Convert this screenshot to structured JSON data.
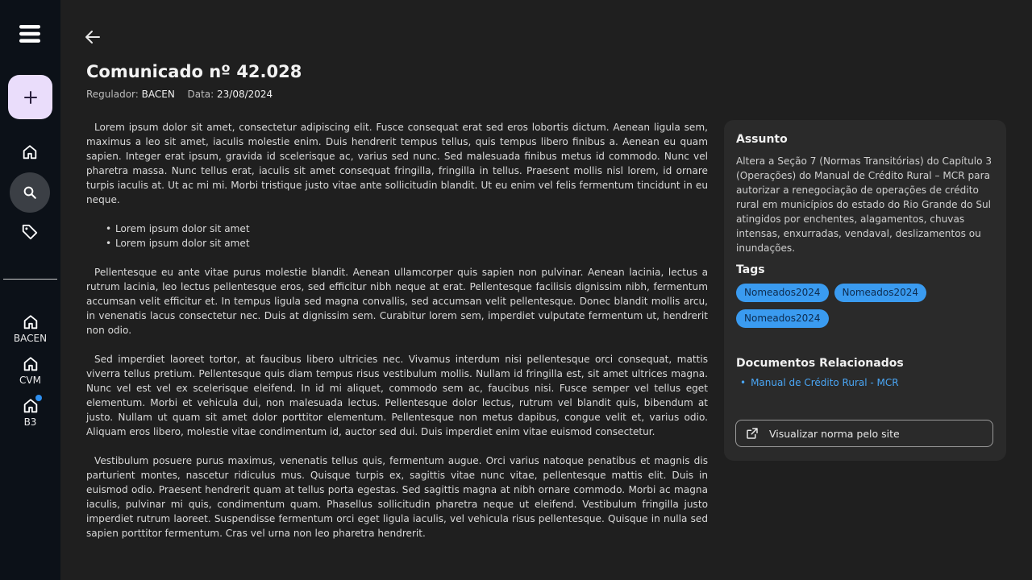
{
  "rail": {
    "regulators": [
      {
        "label": "BACEN"
      },
      {
        "label": "CVM"
      },
      {
        "label": "B3",
        "notification": true
      }
    ]
  },
  "document": {
    "title": "Comunicado nº 42.028",
    "regulator_label": "Regulador:",
    "regulator_value": "BACEN",
    "date_label": "Data:",
    "date_value": "23/08/2024",
    "paragraphs": [
      "Lorem ipsum dolor sit amet, consectetur adipiscing elit. Fusce consequat erat sed eros lobortis dictum. Aenean ligula sem, maximus a leo sit amet, iaculis molestie enim. Duis hendrerit tempus tellus, quis tempus libero finibus a. Aenean eu quam sapien. Integer erat ipsum, gravida id scelerisque ac, varius sed nunc. Sed malesuada finibus metus id commodo. Nunc vel pharetra massa. Nunc tellus erat, iaculis sit amet consequat fringilla, fringilla in tellus. Praesent mollis nisl lorem, id ornare turpis iaculis at. Ut ac mi mi. Morbi tristique justo vitae ante sollicitudin blandit. Ut eu enim vel felis fermentum tincidunt in eu neque.",
      "Pellentesque eu ante vitae purus molestie blandit. Aenean ullamcorper quis sapien non pulvinar. Aenean lacinia, lectus a rutrum lacinia, leo lectus pellentesque eros, sed efficitur nibh neque at erat. Pellentesque facilisis dignissim nibh, fermentum accumsan velit efficitur et. In tempus ligula sed magna convallis, sed accumsan velit pellentesque. Donec blandit mollis arcu, in venenatis lacus consectetur nec. Duis at dignissim sem. Curabitur lorem sem, imperdiet vulputate fermentum ut, hendrerit non odio.",
      "Sed imperdiet laoreet tortor, at faucibus libero ultricies nec. Vivamus interdum nisi pellentesque orci consequat, mattis viverra tellus pretium. Pellentesque quis diam tempus risus vestibulum mollis. Nullam id fringilla est, sit amet ultrices magna. Nunc vel est vel ex scelerisque eleifend. In id mi aliquet, commodo sem ac, faucibus nisi. Fusce semper vel tellus eget elementum. Morbi et vehicula dui, non malesuada lectus. Pellentesque dolor lectus, rutrum vel blandit quis, bibendum at justo. Nullam ut quam sit amet dolor porttitor elementum. Pellentesque non metus dapibus, congue velit et, varius odio. Aliquam eros libero, molestie vitae condimentum id, auctor sed dui. Duis imperdiet enim vitae euismod consectetur.",
      "Vestibulum posuere purus maximus, venenatis tellus quis, fermentum augue. Orci varius natoque penatibus et magnis dis parturient montes, nascetur ridiculus mus. Quisque turpis ex, sagittis vitae nunc vitae, pellentesque mattis elit. Duis in euismod odio. Praesent hendrerit quam at tellus porta egestas. Sed sagittis magna at nibh ornare commodo. Morbi ac magna iaculis, pulvinar mi quis, condimentum quam. Phasellus sollicitudin pharetra neque ut eleifend. Vestibulum fringilla justo imperdiet rutrum laoreet. Suspendisse fermentum orci eget ligula iaculis, vel vehicula risus pellentesque. Quisque in nulla sed sapien porttitor fermentum. Cras vel urna non leo pharetra hendrerit."
    ],
    "bullets": [
      "Lorem ipsum dolor sit amet",
      "Lorem ipsum dolor sit amet"
    ]
  },
  "panel": {
    "subject_heading": "Assunto",
    "subject_text": "Altera a Seção 7 (Normas Transitórias) do Capítulo 3 (Operações) do Manual de Crédito Rural – MCR para autorizar a renegociação de operações de crédito rural em municípios do estado do Rio Grande do Sul atingidos por enchentes, alagamentos, chuvas intensas, enxurradas, vendaval, deslizamentos ou inundações.",
    "tags_heading": "Tags",
    "tags": [
      "Nomeados2024",
      "Nomeados2024",
      "Nomeados2024"
    ],
    "related_heading": "Documentos Relacionados",
    "related_docs": [
      "Manual de Crédito Rural - MCR"
    ],
    "site_button_label": "Visualizar norma pelo site"
  },
  "icons": {
    "menu": "hamburger-menu-icon",
    "add": "plus-icon",
    "home": "home-icon",
    "search": "search-icon",
    "tag": "tag-icon",
    "back": "arrow-left-icon",
    "external": "external-link-icon"
  },
  "colors": {
    "background": "#1f1f1f",
    "rail": "#0c1118",
    "fab": "#eaddfb",
    "panel": "#2a2a2a",
    "tag": "#3a9bf0",
    "link": "#4aa6f5",
    "notification_dot": "#2e8ff0"
  }
}
